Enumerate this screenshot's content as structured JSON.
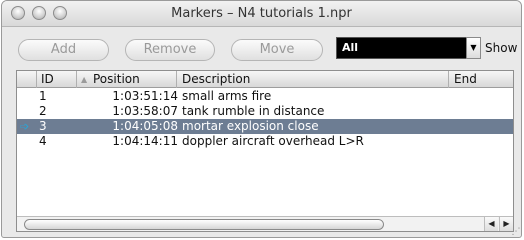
{
  "window": {
    "title": "Markers – N4 tutorials 1.npr"
  },
  "toolbar": {
    "add_label": "Add",
    "remove_label": "Remove",
    "move_label": "Move",
    "filter_value": "All",
    "show_label": "Show"
  },
  "table": {
    "columns": {
      "id": "ID",
      "position": "Position",
      "description": "Description",
      "end": "End"
    },
    "rows": [
      {
        "id": "1",
        "position": "1:03:51:14",
        "description": "small arms fire",
        "end": ""
      },
      {
        "id": "2",
        "position": "1:03:58:07",
        "description": "tank rumble in distance",
        "end": ""
      },
      {
        "id": "3",
        "position": "1:04:05:08",
        "description": "mortar explosion close",
        "end": ""
      },
      {
        "id": "4",
        "position": "1:04:14:11",
        "description": "doppler aircraft overhead L>R",
        "end": ""
      }
    ],
    "selected_row": 3,
    "current_marker_icon": "play-arrow-icon"
  },
  "colors": {
    "selection": "#6d7d93",
    "marker_arrow": "#2aa6d8",
    "filter_bg": "#000000"
  }
}
